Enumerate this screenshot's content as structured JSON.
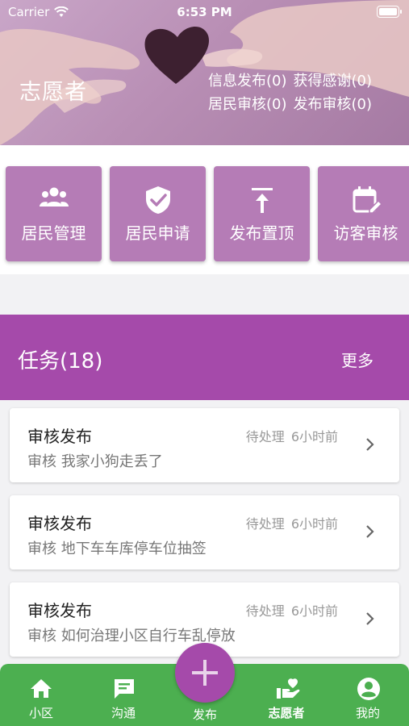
{
  "status_bar": {
    "carrier": "Carrier",
    "time": "6:53 PM"
  },
  "header": {
    "title": "志愿者",
    "stats": {
      "info_publish": "信息发布(0)",
      "thanks_received": "获得感谢(0)",
      "resident_review": "居民审核(0)",
      "publish_review": "发布审核(0)"
    }
  },
  "tiles": [
    {
      "label": "居民管理",
      "icon": "group-icon"
    },
    {
      "label": "居民申请",
      "icon": "shield-check-icon"
    },
    {
      "label": "发布置顶",
      "icon": "pin-top-icon"
    },
    {
      "label": "访客审核",
      "icon": "calendar-edit-icon"
    }
  ],
  "tasks": {
    "title": "任务(18)",
    "more_label": "更多",
    "items": [
      {
        "title": "审核发布",
        "status": "待处理",
        "time": "6小时前",
        "desc": "审核 我家小狗走丢了"
      },
      {
        "title": "审核发布",
        "status": "待处理",
        "time": "6小时前",
        "desc": "审核 地下车车库停车位抽签"
      },
      {
        "title": "审核发布",
        "status": "待处理",
        "time": "6小时前",
        "desc": "审核 如何治理小区自行车乱停放"
      }
    ]
  },
  "tabbar": {
    "items": [
      {
        "label": "小区",
        "icon": "home-icon"
      },
      {
        "label": "沟通",
        "icon": "chat-icon"
      },
      {
        "label": "发布",
        "icon": "plus-icon"
      },
      {
        "label": "志愿者",
        "icon": "volunteer-icon",
        "active": true
      },
      {
        "label": "我的",
        "icon": "account-icon"
      }
    ]
  },
  "colors": {
    "accent_purple": "#a54aaa",
    "tile_purple": "#b57cb6",
    "tabbar_green": "#4caf50"
  }
}
